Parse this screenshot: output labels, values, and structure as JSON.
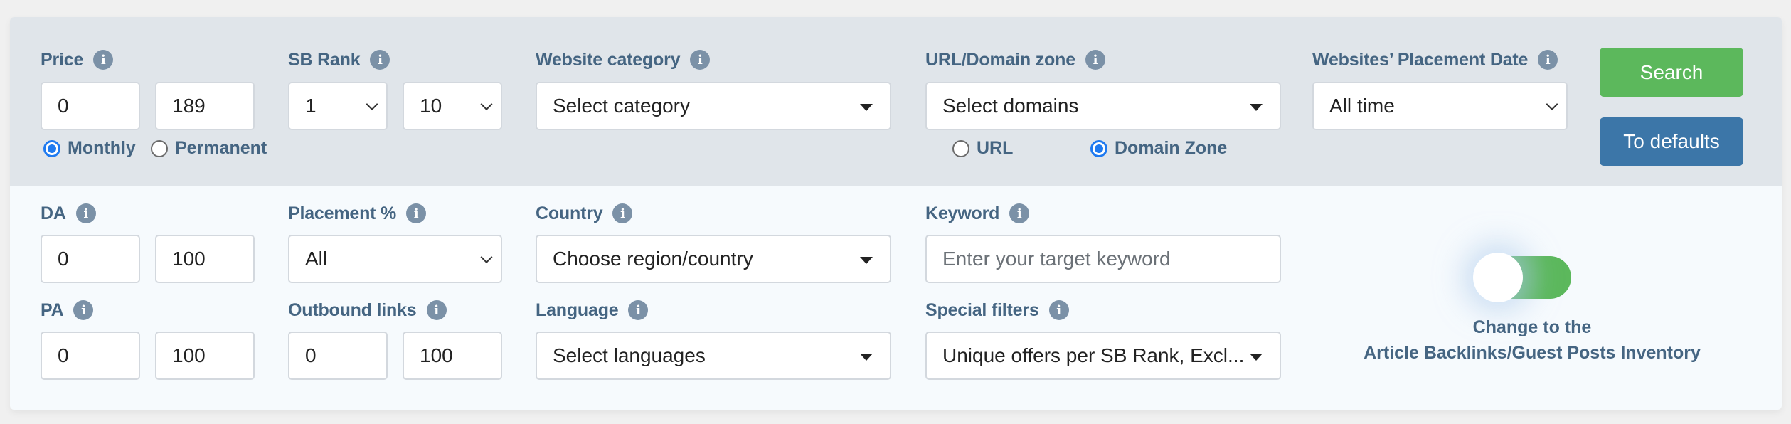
{
  "filters": {
    "price": {
      "label": "Price",
      "min": "0",
      "max": "189",
      "period_options": [
        {
          "label": "Monthly",
          "checked": true
        },
        {
          "label": "Permanent",
          "checked": false
        }
      ]
    },
    "sb_rank": {
      "label": "SB Rank",
      "min": "1",
      "max": "10"
    },
    "website_category": {
      "label": "Website category",
      "placeholder": "Select category"
    },
    "url_domain_zone": {
      "label": "URL/Domain zone",
      "placeholder": "Select domains",
      "mode_options": [
        {
          "label": "URL",
          "checked": false
        },
        {
          "label": "Domain Zone",
          "checked": true
        }
      ]
    },
    "placement_date": {
      "label": "Websites’ Placement Date",
      "value": "All time"
    },
    "da": {
      "label": "DA",
      "min": "0",
      "max": "100"
    },
    "placement_percent": {
      "label": "Placement %",
      "value": "All"
    },
    "country": {
      "label": "Country",
      "placeholder": "Choose region/country"
    },
    "keyword": {
      "label": "Keyword",
      "value": "",
      "placeholder": "Enter your target keyword"
    },
    "pa": {
      "label": "PA",
      "min": "0",
      "max": "100"
    },
    "outbound_links": {
      "label": "Outbound links",
      "min": "0",
      "max": "100"
    },
    "language": {
      "label": "Language",
      "placeholder": "Select languages"
    },
    "special_filters": {
      "label": "Special filters",
      "value": "Unique offers per SB Rank, Excl..."
    }
  },
  "actions": {
    "search_label": "Search",
    "defaults_label": "To defaults"
  },
  "inventory_toggle": {
    "line1": "Change to the",
    "line2": "Article Backlinks/Guest Posts Inventory",
    "on": true
  },
  "icons": {
    "info": "i"
  },
  "colors": {
    "search": "#5cb85c",
    "defaults": "#3c76a8",
    "label": "#456582",
    "radio_active": "#1f7af0"
  }
}
